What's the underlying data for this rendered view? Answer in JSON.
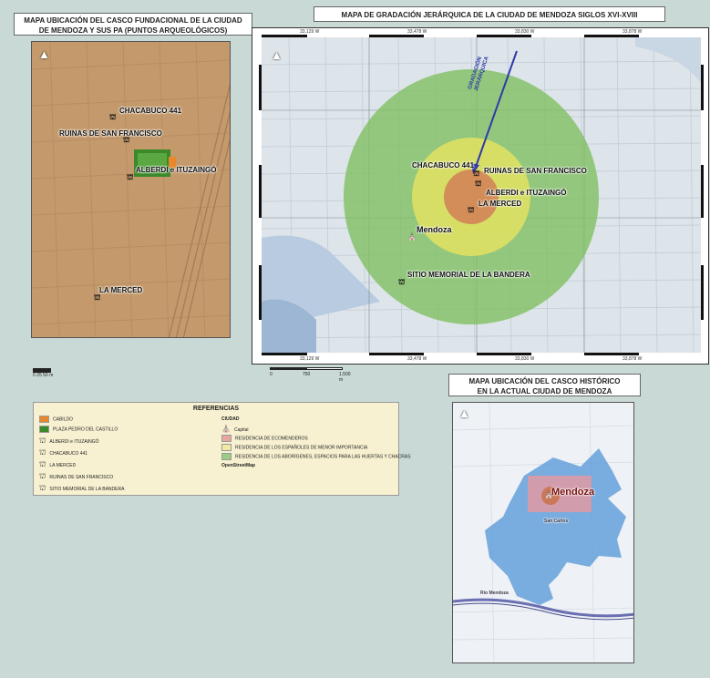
{
  "map1": {
    "title_line1": "MAPA UBICACIÓN DEL CASCO FUNDACIONAL DE LA CIUDAD",
    "title_line2": "DE MENDOZA Y SUS PA (PUNTOS ARQUEOLÓGICOS)",
    "labels": {
      "chacabuco": "CHACABUCO 441",
      "ruinas": "RUINAS DE SAN FRANCISCO",
      "alberdi": "ALBERDI e ITUZAINGÓ",
      "merced": "LA MERCED"
    },
    "scale_text": "0  25 50 m"
  },
  "map2": {
    "title": "MAPA DE GRADACIÓN JERÁRQUICA DE LA CIUDAD DE MENDOZA SIGLOS XVI-XVIII",
    "arrow_label_1": "GRADACIÓN",
    "arrow_label_2": "JERÁRQUICA",
    "labels": {
      "chacabuco": "CHACABUCO 441",
      "ruinas": "RUINAS DE SAN FRANCISCO",
      "alberdi": "ALBERDI e ITUZAINGÓ",
      "merced": "LA MERCED",
      "mendoza": "Mendoza",
      "sitio": "SITIO MEMORIAL DE LA BANDERA"
    },
    "top_ticks": [
      "33,129 W",
      "33,478 W",
      "33,830 W",
      "33,878 W"
    ],
    "bottom_ticks": [
      "33,129 W",
      "33,478 W",
      "33,830 W",
      "33,878 W"
    ],
    "scale_0": "0",
    "scale_1": "750",
    "scale_2": "1.500 m"
  },
  "map3": {
    "title_line1": "MAPA UBICACIÓN DEL CASCO HISTÓRICO",
    "title_line2": "EN LA ACTUAL CIUDAD DE MENDOZA",
    "label_mendoza": "Mendoza",
    "label_sub": "San Carlos",
    "river_label": "Río Mendoza"
  },
  "legend": {
    "title": "REFERENCIAS",
    "items_left": [
      "CABILDO",
      "PLAZA PEDRO DEL CASTILLO",
      "ALBERDI e ITUZAINGÓ",
      "CHACABUCO 441",
      "LA MERCED",
      "RUINAS DE SAN FRANCISCO",
      "SITIO MEMORIAL DE LA BANDERA"
    ],
    "ciudad_header": "CIUDAD",
    "capital": "Capital",
    "items_right": [
      "RESIDENCIA DE ECOMENDEROS",
      "RESIDENCIA DE LOS ESPAÑOLES DE MENOR IMPORTANCIA",
      "RESIDENCIA DE LOS ABORÍGENES, ESPACIOS PARA LAS HUERTAS Y CHACRAS"
    ],
    "osm": "OpenStreetMap",
    "colors": {
      "cabildo": "#e8872b",
      "plaza": "#3a8a2a",
      "encomenderos": "#e9a6a0",
      "espanoles": "#f1e9a2",
      "aborigenes": "#9ccc85"
    }
  }
}
